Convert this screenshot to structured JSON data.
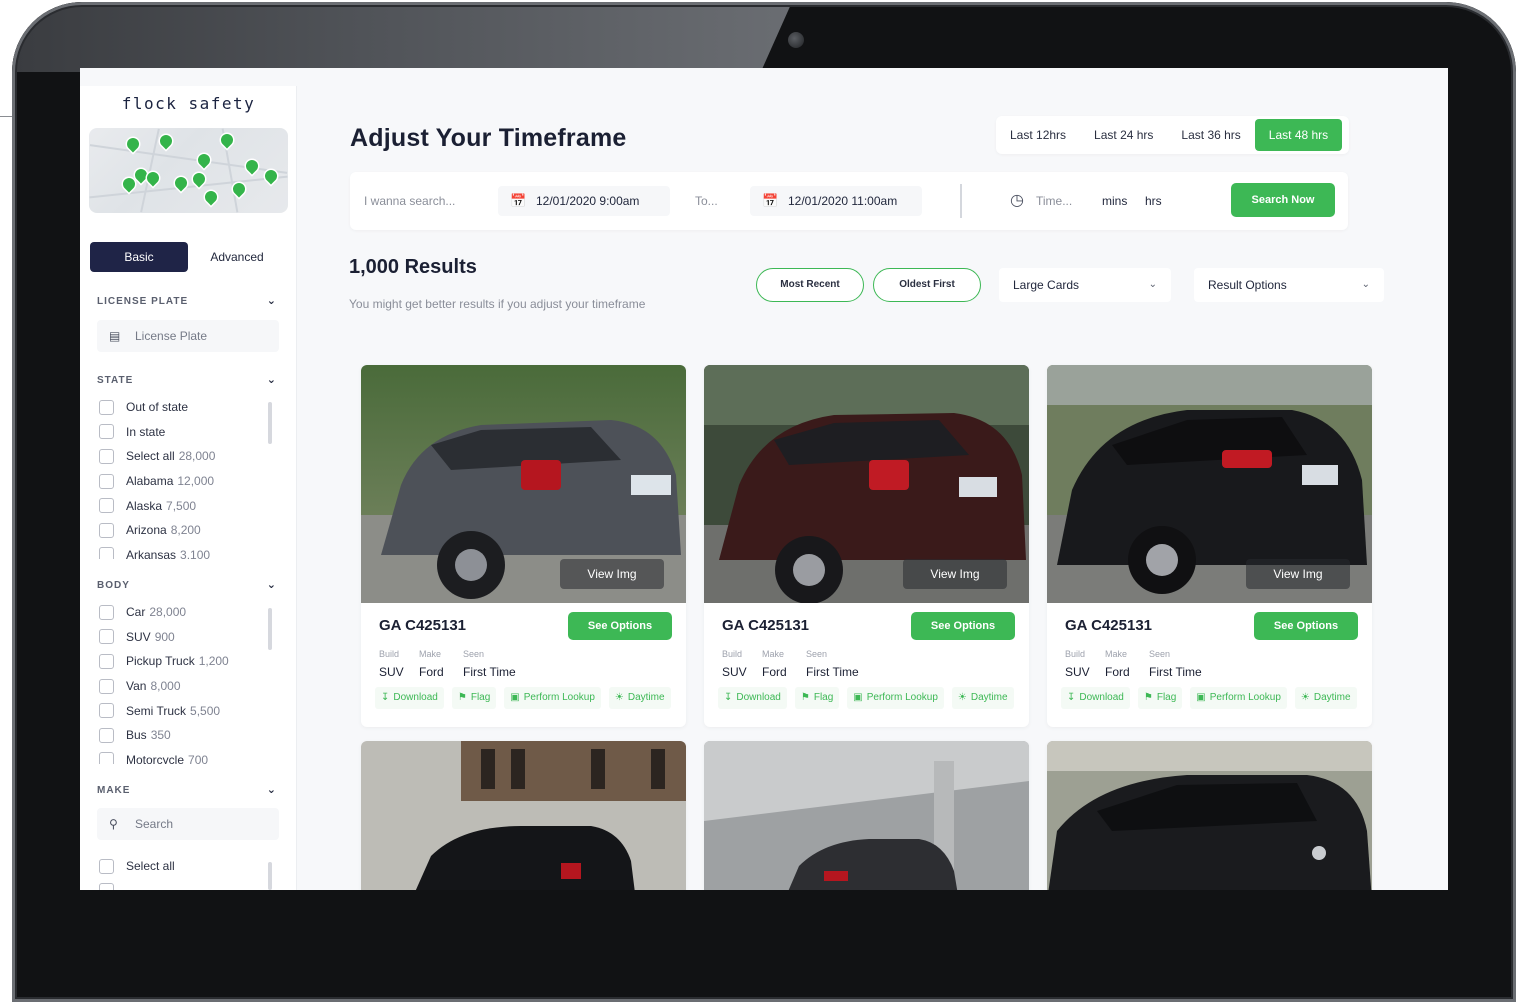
{
  "brand": {
    "logo_text": "flock safety",
    "accent": "#3db855",
    "navy": "#1f2447"
  },
  "sidebar": {
    "tabs": [
      "Basic",
      "Advanced"
    ],
    "license_plate": {
      "heading": "LICENSE PLATE",
      "placeholder": "License Plate"
    },
    "state": {
      "heading": "STATE",
      "items": [
        {
          "label": "Out of state",
          "count": ""
        },
        {
          "label": "In state",
          "count": ""
        },
        {
          "label": "Select all",
          "count": "28,000"
        },
        {
          "label": "Alabama",
          "count": "12,000"
        },
        {
          "label": "Alaska",
          "count": "7,500"
        },
        {
          "label": "Arizona",
          "count": "8,200"
        },
        {
          "label": "Arkansas",
          "count": "3,100"
        }
      ]
    },
    "body": {
      "heading": "BODY",
      "items": [
        {
          "label": "Car",
          "count": "28,000"
        },
        {
          "label": "SUV",
          "count": "900"
        },
        {
          "label": "Pickup Truck",
          "count": "1,200"
        },
        {
          "label": "Van",
          "count": "8,000"
        },
        {
          "label": "Semi Truck",
          "count": "5,500"
        },
        {
          "label": "Bus",
          "count": "350"
        },
        {
          "label": "Motorcycle",
          "count": "700"
        }
      ]
    },
    "make": {
      "heading": "MAKE",
      "search_placeholder": "Search",
      "items": [
        {
          "label": "Select all",
          "count": ""
        }
      ]
    }
  },
  "main": {
    "title": "Adjust Your Timeframe",
    "ranges": [
      "Last 12hrs",
      "Last 24 hrs",
      "Last 36 hrs",
      "Last 48 hrs"
    ],
    "active_range": "Last 48 hrs",
    "search": {
      "placeholder": "I wanna search...",
      "from_date": "12/01/2020 9:00am",
      "to_label": "To...",
      "to_date": "12/01/2020 11:00am",
      "time_placeholder": "Time...",
      "mins": "mins",
      "hrs": "hrs",
      "button": "Search Now"
    },
    "results": {
      "count": "1,000 Results",
      "hint": "You might get better results if you adjust your timeframe",
      "sort_recent": "Most Recent",
      "sort_oldest": "Oldest First",
      "view_select": "Large Cards",
      "options_select": "Result Options"
    },
    "cards": [
      {
        "plate": "GA C425131",
        "options": "See Options",
        "view": "View Img",
        "build_label": "Build",
        "make_label": "Make",
        "seen_label": "Seen",
        "build": "SUV",
        "make": "Ford",
        "seen": "First Time",
        "actions": [
          "Download",
          "Flag",
          "Perform Lookup",
          "Daytime"
        ]
      },
      {
        "plate": "GA C425131",
        "options": "See Options",
        "view": "View Img",
        "build_label": "Build",
        "make_label": "Make",
        "seen_label": "Seen",
        "build": "SUV",
        "make": "Ford",
        "seen": "First Time",
        "actions": [
          "Download",
          "Flag",
          "Perform Lookup",
          "Daytime"
        ]
      },
      {
        "plate": "GA C425131",
        "options": "See Options",
        "view": "View Img",
        "build_label": "Build",
        "make_label": "Make",
        "seen_label": "Seen",
        "build": "SUV",
        "make": "Ford",
        "seen": "First Time",
        "actions": [
          "Download",
          "Flag",
          "Perform Lookup",
          "Daytime"
        ]
      }
    ]
  }
}
